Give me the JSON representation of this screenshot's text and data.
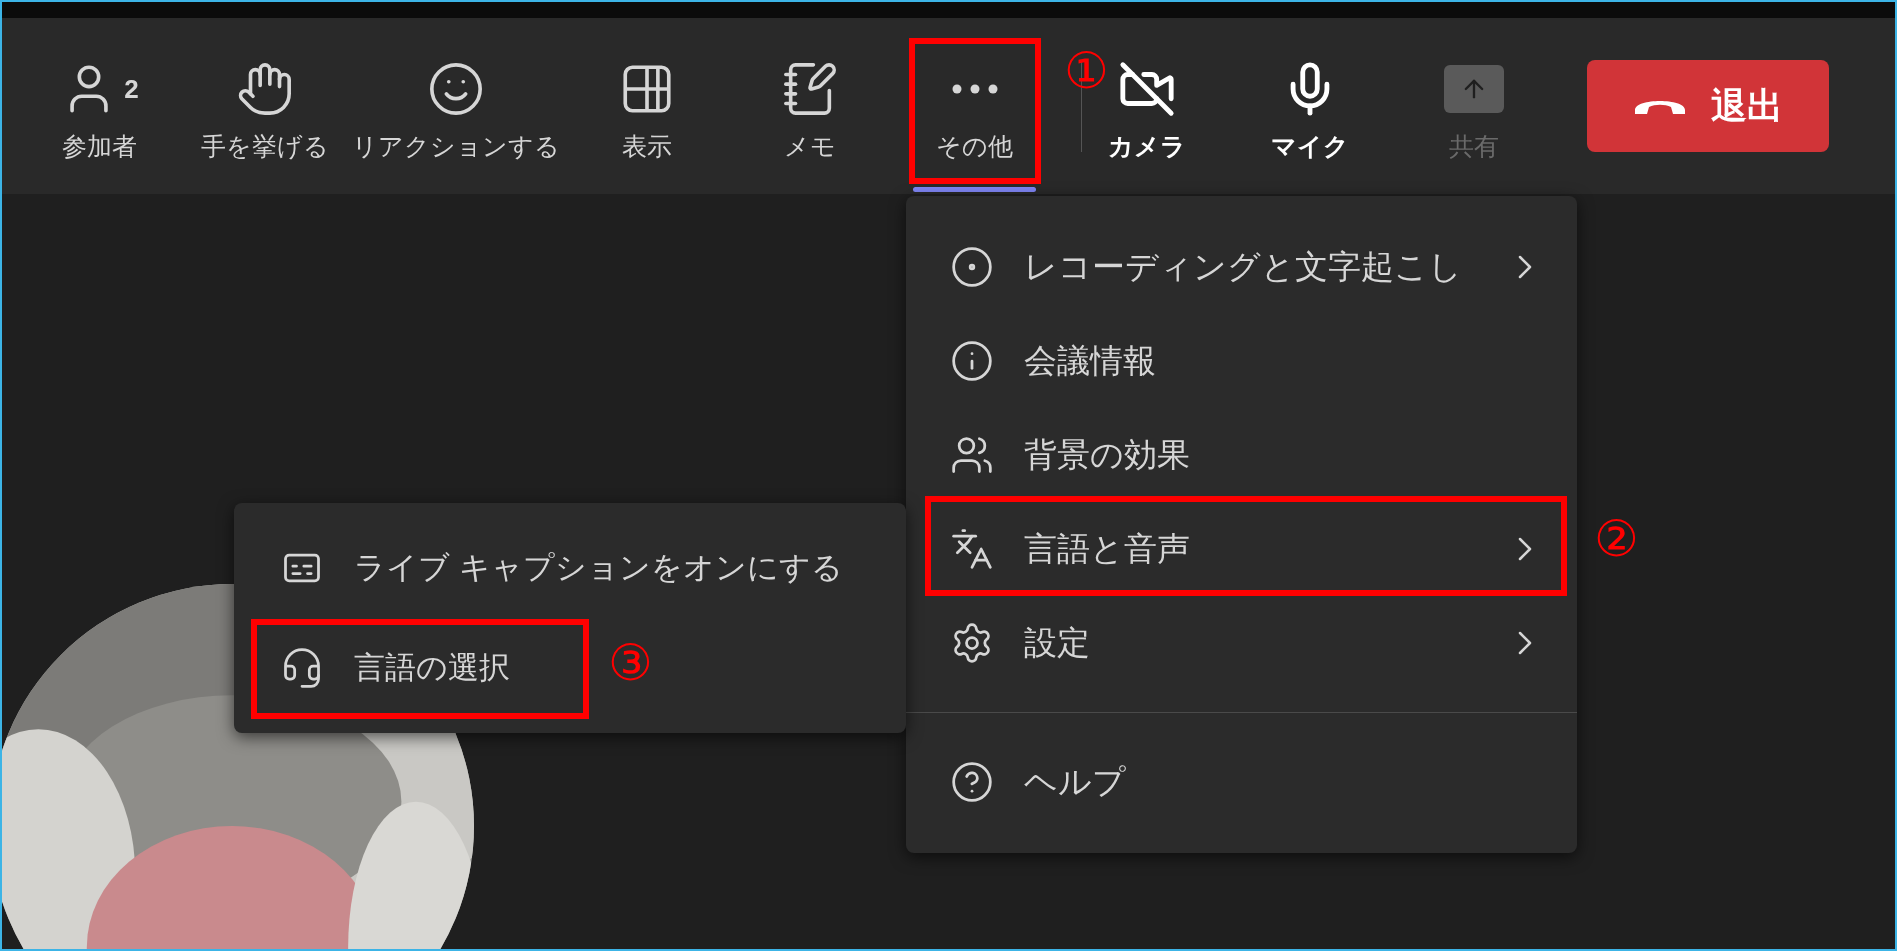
{
  "toolbar": {
    "items": [
      {
        "kind": "participants",
        "label": "参加者",
        "count": "2",
        "selected": false,
        "disabled": false
      },
      {
        "kind": "hand",
        "label": "手を挙げる",
        "selected": false,
        "disabled": false
      },
      {
        "kind": "reaction",
        "label": "リアクションする",
        "selected": false,
        "disabled": false
      },
      {
        "kind": "view",
        "label": "表示",
        "selected": false,
        "disabled": false
      },
      {
        "kind": "notes",
        "label": "メモ",
        "selected": false,
        "disabled": false
      },
      {
        "kind": "more",
        "label": "その他",
        "selected": true,
        "disabled": false
      },
      {
        "kind": "camera",
        "label": "カメラ",
        "selected": false,
        "disabled": false
      },
      {
        "kind": "mic",
        "label": "マイク",
        "selected": false,
        "disabled": false
      },
      {
        "kind": "share",
        "label": "共有",
        "selected": false,
        "disabled": true
      }
    ],
    "leave_button": "退出"
  },
  "more_menu": {
    "items": [
      {
        "kind": "record",
        "label": "レコーディングと文字起こし",
        "has_submenu": true,
        "separator_before": false
      },
      {
        "kind": "info",
        "label": "会議情報",
        "has_submenu": false,
        "separator_before": false
      },
      {
        "kind": "background",
        "label": "背景の効果",
        "has_submenu": false,
        "separator_before": false
      },
      {
        "kind": "language",
        "label": "言語と音声",
        "has_submenu": true,
        "separator_before": false
      },
      {
        "kind": "settings",
        "label": "設定",
        "has_submenu": true,
        "separator_before": false
      },
      {
        "kind": "help",
        "label": "ヘルプ",
        "has_submenu": false,
        "separator_before": true
      }
    ]
  },
  "language_submenu": {
    "items": [
      {
        "kind": "captions",
        "label": "ライブ キャプションをオンにする"
      },
      {
        "kind": "headset",
        "label": "言語の選択"
      }
    ]
  },
  "annotations": [
    {
      "number": "①"
    },
    {
      "number": "②"
    },
    {
      "number": "③"
    }
  ]
}
